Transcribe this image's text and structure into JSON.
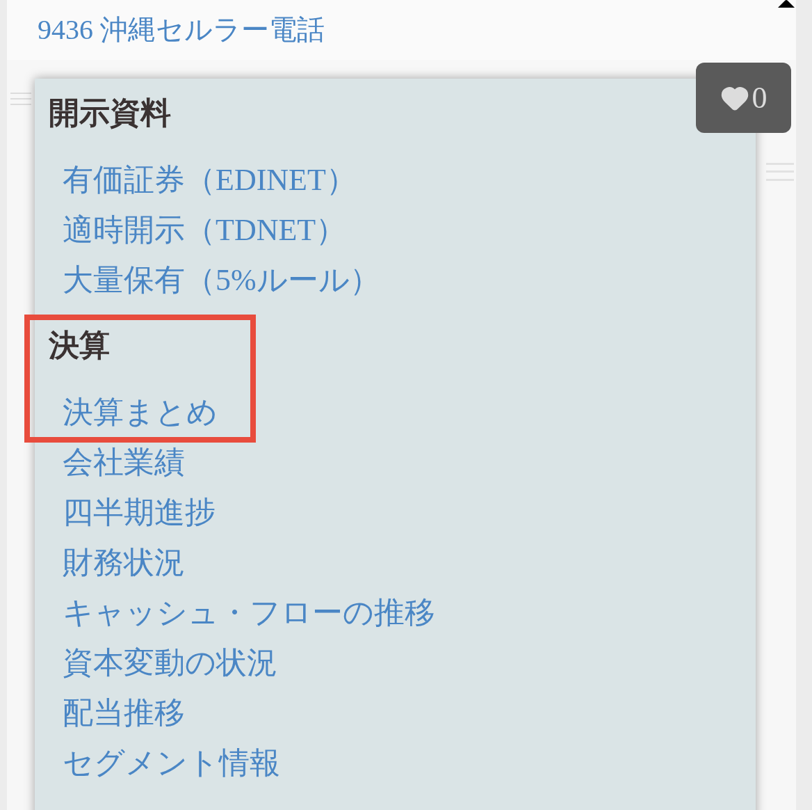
{
  "header": {
    "title": "9436 沖縄セルラー電話"
  },
  "favorite": {
    "count": "0"
  },
  "menu": {
    "sections": [
      {
        "heading": "開示資料",
        "highlighted": false,
        "links": [
          "有価証券（EDINET）",
          "適時開示（TDNET）",
          "大量保有（5%ルール）"
        ]
      },
      {
        "heading": "決算",
        "highlighted": true,
        "links": [
          "決算まとめ",
          "会社業績",
          "四半期進捗",
          "財務状況",
          "キャッシュ・フローの推移",
          "資本変動の状況",
          "配当推移",
          "セグメント情報"
        ]
      }
    ]
  }
}
